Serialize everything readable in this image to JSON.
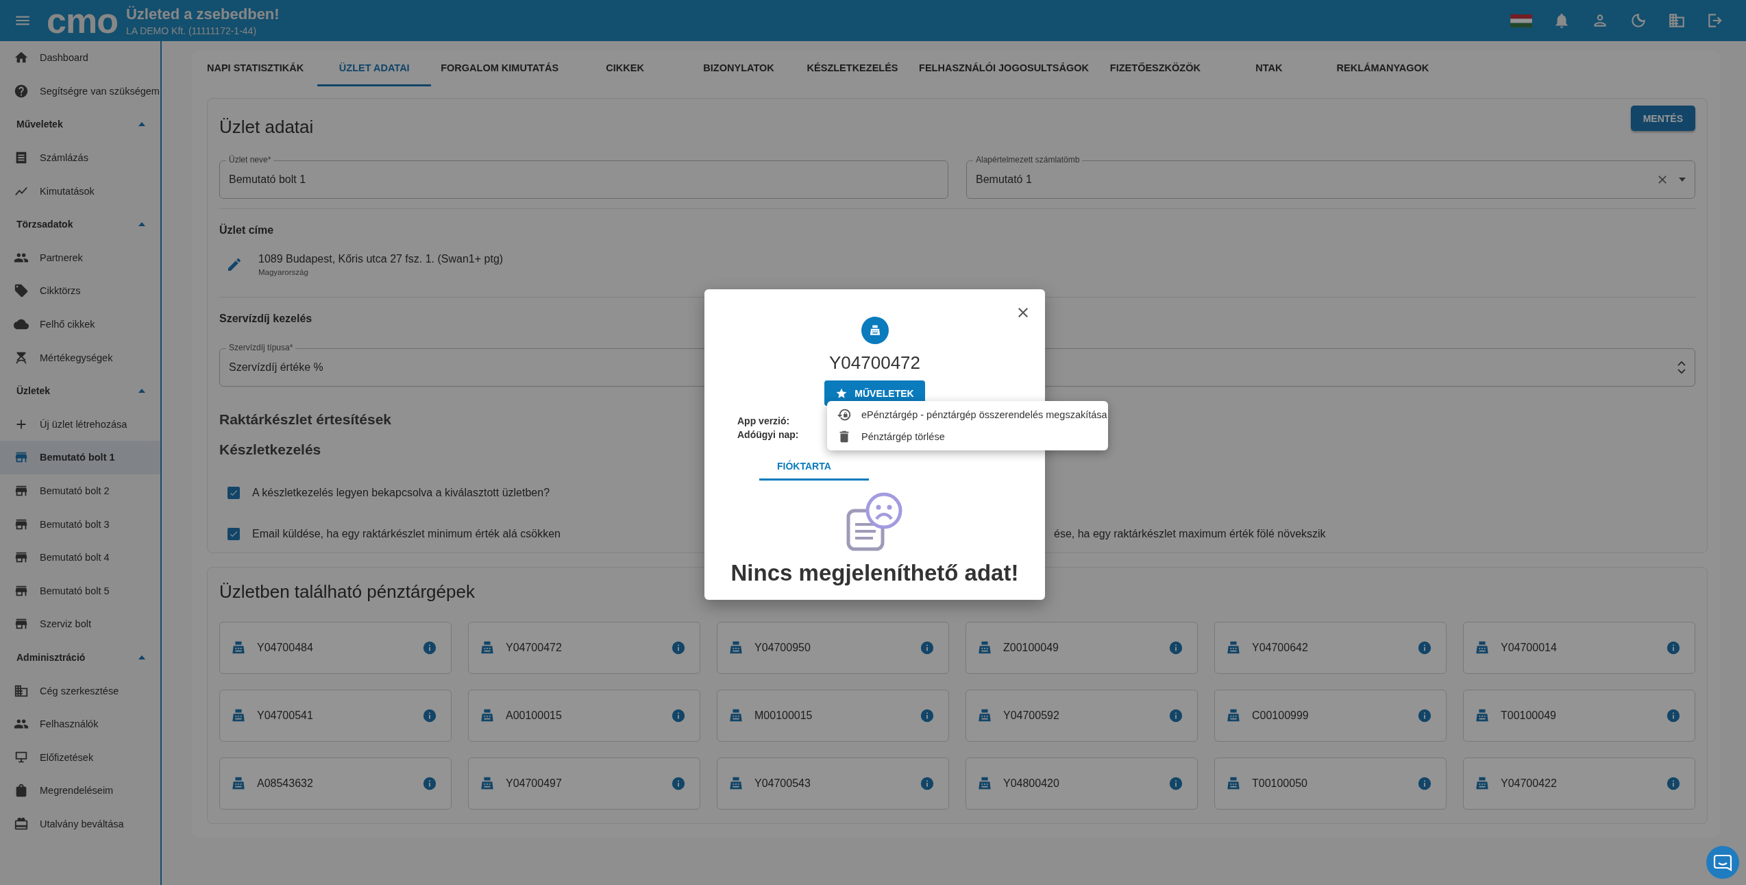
{
  "header": {
    "logo": "cmo",
    "title": "Üzleted a zsebedben!",
    "subtitle": "LA DEMO Kft. (11111172-1-44)"
  },
  "sidebar": {
    "items": [
      {
        "kind": "link",
        "label": "Dashboard",
        "selected": false
      },
      {
        "kind": "link",
        "label": "Segítségre van szükségem",
        "selected": false
      },
      {
        "kind": "section",
        "label": "Műveletek",
        "expanded": true
      },
      {
        "kind": "link",
        "label": "Számlázás",
        "selected": false
      },
      {
        "kind": "link",
        "label": "Kimutatások",
        "selected": false
      },
      {
        "kind": "section",
        "label": "Törzsadatok",
        "expanded": true
      },
      {
        "kind": "link",
        "label": "Partnerek",
        "selected": false
      },
      {
        "kind": "link",
        "label": "Cikktörzs",
        "selected": false
      },
      {
        "kind": "link",
        "label": "Felhő cikkek",
        "selected": false
      },
      {
        "kind": "link",
        "label": "Mértékegységek",
        "selected": false
      },
      {
        "kind": "section",
        "label": "Üzletek",
        "expanded": true
      },
      {
        "kind": "link",
        "label": "Új üzlet létrehozása",
        "selected": false
      },
      {
        "kind": "link",
        "label": "Bemutató bolt 1",
        "selected": true
      },
      {
        "kind": "link",
        "label": "Bemutató bolt 2",
        "selected": false
      },
      {
        "kind": "link",
        "label": "Bemutató bolt 3",
        "selected": false
      },
      {
        "kind": "link",
        "label": "Bemutató bolt 4",
        "selected": false
      },
      {
        "kind": "link",
        "label": "Bemutató bolt 5",
        "selected": false
      },
      {
        "kind": "link",
        "label": "Szerviz bolt",
        "selected": false
      },
      {
        "kind": "section",
        "label": "Adminisztráció",
        "expanded": true
      },
      {
        "kind": "link",
        "label": "Cég szerkesztése",
        "selected": false
      },
      {
        "kind": "link",
        "label": "Felhasználók",
        "selected": false
      },
      {
        "kind": "link",
        "label": "Előfizetések",
        "selected": false
      },
      {
        "kind": "link",
        "label": "Megrendeléseim",
        "selected": false
      },
      {
        "kind": "link",
        "label": "Utalvány beváltása",
        "selected": false
      }
    ]
  },
  "tabs": [
    {
      "label": "NAPI STATISZTIKÁK",
      "selected": false
    },
    {
      "label": "ÜZLET ADATAI",
      "selected": true
    },
    {
      "label": "FORGALOM KIMUTATÁS",
      "selected": false
    },
    {
      "label": "CIKKEK",
      "selected": false
    },
    {
      "label": "BIZONYLATOK",
      "selected": false
    },
    {
      "label": "KÉSZLETKEZELÉS",
      "selected": false
    },
    {
      "label": "FELHASZNÁLÓI JOGOSULTSÁGOK",
      "selected": false
    },
    {
      "label": "FIZETŐESZKÖZÖK",
      "selected": false
    },
    {
      "label": "NTAK",
      "selected": false
    },
    {
      "label": "REKLÁMANYAGOK",
      "selected": false
    }
  ],
  "store_card": {
    "title": "Üzlet adatai",
    "save_button": "MENTÉS",
    "name_field": {
      "label": "Üzlet neve*",
      "value": "Bemutató bolt 1"
    },
    "invoice_field": {
      "label": "Alapértelmezett számlatömb",
      "value": "Bemutató 1"
    },
    "address_heading": "Üzlet címe",
    "address": "1089 Budapest, Kőris utca 27 fsz. 1. (Swan1+ ptg)",
    "country": "Magyarország",
    "service_heading": "Szervízdíj kezelés",
    "service_field": {
      "label": "Szervízdíj típusa*",
      "value": "Szervízdíj értéke %"
    },
    "stock_notice_heading": "Raktárkészlet értesítések",
    "stock_heading": "Készletkezelés",
    "stock_enabled": {
      "label": "A készletkezelés legyen bekapcsolva a kiválasztott üzletben?",
      "checked": true
    },
    "min_email": {
      "label": "Email küldése, ha egy raktárkészlet minimum érték alá csökken",
      "checked": true
    },
    "max_email_fragment": "ése, ha egy raktárkészlet maximum érték fölé növekszik"
  },
  "registers_card": {
    "title": "Üzletben található pénztárgépek",
    "registers": [
      "Y04700484",
      "Y04700472",
      "Y04700950",
      "Z00100049",
      "Y04700642",
      "Y04700014",
      "Y04700541",
      "A00100015",
      "M00100015",
      "Y04700592",
      "C00100999",
      "T00100049",
      "A08543632",
      "Y04700497",
      "Y04700543",
      "Y04800420",
      "T00100050",
      "Y04700422"
    ]
  },
  "dialog": {
    "serial": "Y04700472",
    "actions_button": "MŰVELETEK",
    "info": [
      "App verzió:",
      "Adóügyi nap:"
    ],
    "tabs": [
      {
        "label": "FIÓKTARTA",
        "selected": true
      }
    ],
    "empty_message": "Nincs megjeleníthető adat!",
    "menu": [
      "ePénztárgép - pénztárgép összerendelés megszakítása",
      "Pénztárgép törlése"
    ]
  }
}
